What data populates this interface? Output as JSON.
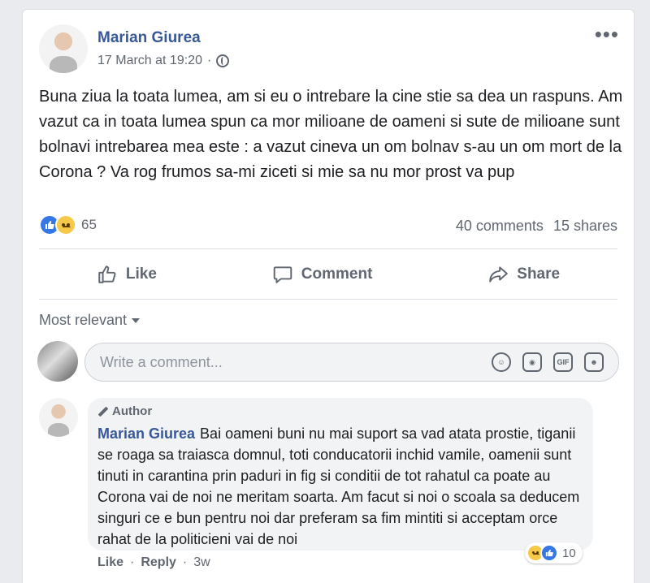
{
  "post": {
    "author": "Marian Giurea",
    "timestamp": "17 March at 19:20",
    "privacy_icon": "globe-icon",
    "menu_icon": "more-icon",
    "text": "Buna ziua la toata lumea, am si eu o intrebare la cine stie sa dea un raspuns. Am vazut ca in toata lumea spun ca mor milioane de oameni si sute de milioane sunt bolnavi intrebarea mea este : a vazut cineva un om bolnav s-au un om mort de la Corona ? Va rog frumos sa-mi ziceti si mie sa nu mor prost va pup",
    "reaction_count": "65",
    "comments_count": "40 comments",
    "shares_count": "15 shares"
  },
  "actions": {
    "like": "Like",
    "comment": "Comment",
    "share": "Share"
  },
  "comments_section": {
    "sort_label": "Most relevant",
    "input_placeholder": "Write a comment...",
    "input_icons": [
      "emoji-icon",
      "camera-icon",
      "gif-icon",
      "sticker-icon"
    ]
  },
  "reply": {
    "badge": "Author",
    "author": "Marian Giurea",
    "text": "Bai oameni buni nu mai suport sa vad atata prostie, tiganii se roaga sa traiasca domnul, toti conducatorii inchid vamile, oamenii sunt tinuti in carantina prin paduri in fig si conditii de tot rahatul ca poate au Corona vai de noi ne meritam soarta. Am facut si noi o scoala sa deducem singuri ce e bun pentru noi dar preferam sa fim mintiti si acceptam orce rahat de la politicieni vai de noi",
    "reaction_count": "10",
    "like_label": "Like",
    "reply_label": "Reply",
    "age": "3w"
  },
  "colors": {
    "link_blue": "#385898",
    "like_blue": "#3578e5",
    "secondary_text": "#606770",
    "background": "#e9ebee"
  }
}
